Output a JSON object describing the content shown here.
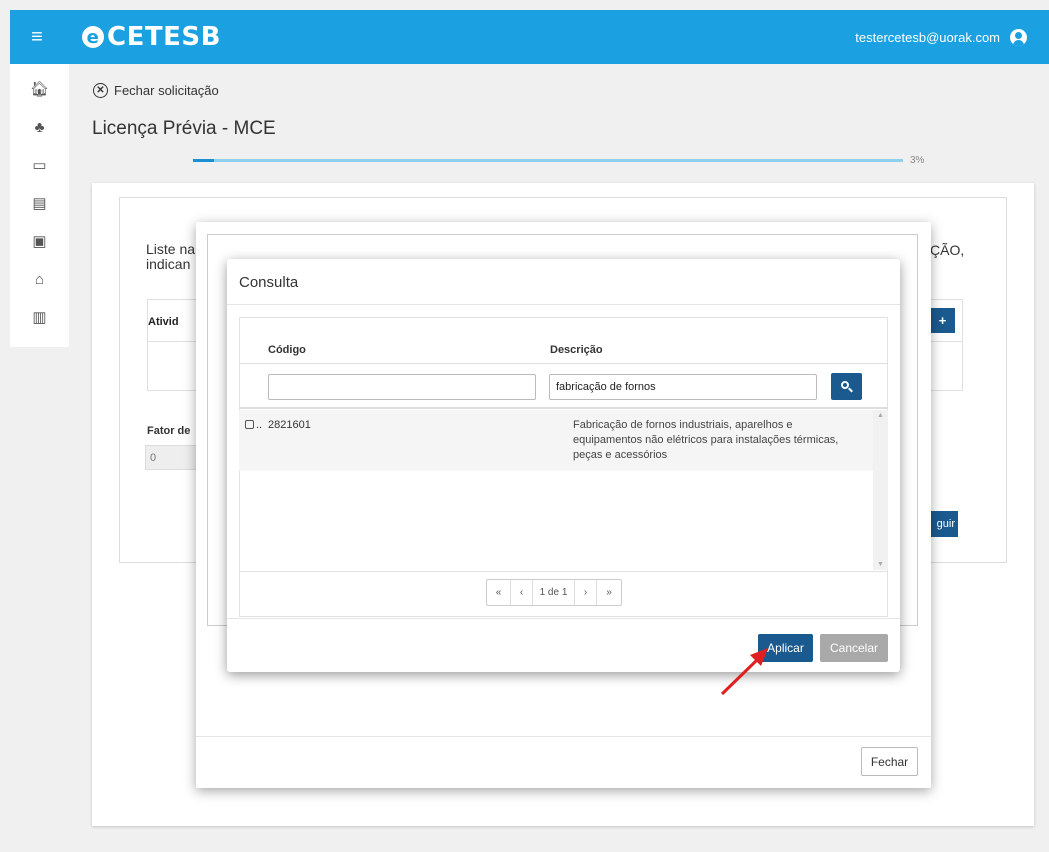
{
  "header": {
    "logo": "CETESB",
    "logo_mark": "e",
    "user_email": "testercetesb@uorak.com"
  },
  "sidebar": {
    "items": [
      {
        "name": "home-icon",
        "glyph": "🏠︎"
      },
      {
        "name": "tree-icon",
        "glyph": "♣"
      },
      {
        "name": "laptop-search-icon",
        "glyph": "▭"
      },
      {
        "name": "archive-icon",
        "glyph": "▤"
      },
      {
        "name": "briefcase-icon",
        "glyph": "▣"
      },
      {
        "name": "house-icon",
        "glyph": "⌂"
      },
      {
        "name": "buildings-icon",
        "glyph": "▥"
      }
    ]
  },
  "page": {
    "close_request": "Fechar solicitação",
    "title": "Licença Prévia - MCE",
    "progress_label": "3%",
    "progress_value": 3
  },
  "background": {
    "text_line1": "Liste na",
    "text_line2": "indican",
    "text_right": "ÇÃO,",
    "table_header": "Ativid",
    "fator_label": "Fator de",
    "fator_value": "0",
    "next_button": "guir"
  },
  "outer_modal": {
    "close_button": "Fechar"
  },
  "consulta": {
    "title": "Consulta",
    "columns": {
      "codigo": "Código",
      "descricao": "Descrição"
    },
    "filters": {
      "codigo_value": "",
      "descricao_value": "fabricação de fornos"
    },
    "rows": [
      {
        "dots": "..",
        "code": "2821601",
        "description": "Fabricação de fornos industriais, aparelhos e equipamentos não elétricos para instalações térmicas, peças e acessórios"
      }
    ],
    "pager": {
      "first": "«",
      "prev": "‹",
      "page_info": "1 de 1",
      "next": "›",
      "last": "»"
    },
    "apply_button": "Aplicar",
    "cancel_button": "Cancelar"
  },
  "colors": {
    "brand": "#1ba1e2",
    "primary_button": "#1a5a8f",
    "annotation_arrow": "#e02020"
  }
}
